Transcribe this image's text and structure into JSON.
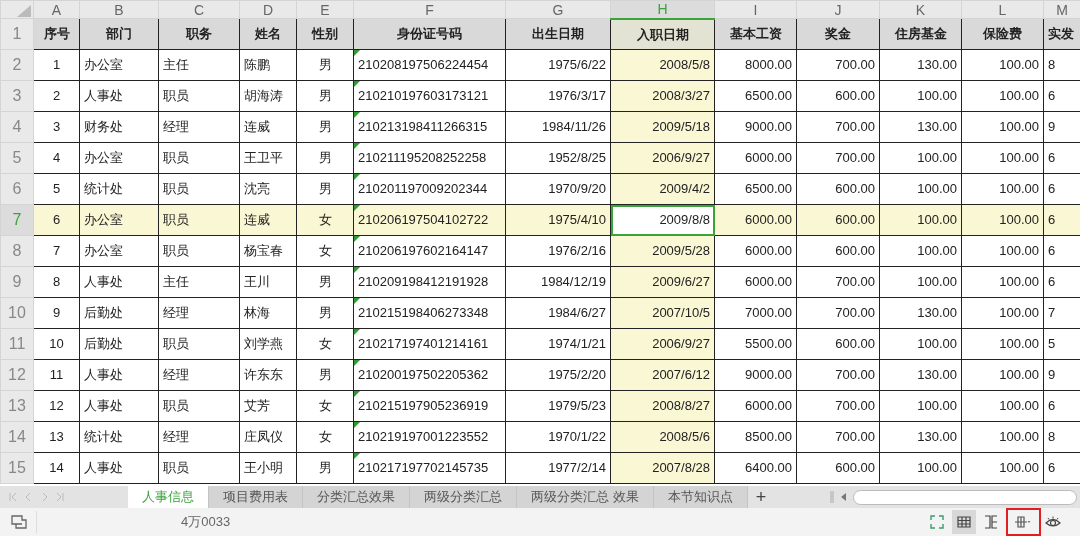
{
  "columns": [
    {
      "letter": "A",
      "header": "序号",
      "kind": "center",
      "selected": false
    },
    {
      "letter": "B",
      "header": "部门",
      "kind": "left",
      "selected": false
    },
    {
      "letter": "C",
      "header": "职务",
      "kind": "left",
      "selected": false
    },
    {
      "letter": "D",
      "header": "姓名",
      "kind": "left",
      "selected": false
    },
    {
      "letter": "E",
      "header": "性别",
      "kind": "center",
      "selected": false
    },
    {
      "letter": "F",
      "header": "身份证号码",
      "kind": "left",
      "selected": false,
      "text_number_flag": true
    },
    {
      "letter": "G",
      "header": "出生日期",
      "kind": "right",
      "selected": false
    },
    {
      "letter": "H",
      "header": "入职日期",
      "kind": "right",
      "selected": true
    },
    {
      "letter": "I",
      "header": "基本工资",
      "kind": "right",
      "selected": false
    },
    {
      "letter": "J",
      "header": "奖金",
      "kind": "right",
      "selected": false
    },
    {
      "letter": "K",
      "header": "住房基金",
      "kind": "right",
      "selected": false
    },
    {
      "letter": "L",
      "header": "保险费",
      "kind": "right",
      "selected": false
    },
    {
      "letter": "M",
      "header": "实发",
      "kind": "left",
      "selected": false
    }
  ],
  "header_row": {
    "number": "1",
    "selected": false
  },
  "rows": [
    {
      "number": "2",
      "selected": false,
      "cells": [
        "1",
        "办公室",
        "主任",
        "陈鹏",
        "男",
        "210208197506224454",
        "1975/6/22",
        "2008/5/8",
        "8000.00",
        "700.00",
        "130.00",
        "100.00",
        "8"
      ]
    },
    {
      "number": "3",
      "selected": false,
      "cells": [
        "2",
        "人事处",
        "职员",
        "胡海涛",
        "男",
        "210210197603173121",
        "1976/3/17",
        "2008/3/27",
        "6500.00",
        "600.00",
        "100.00",
        "100.00",
        "6"
      ]
    },
    {
      "number": "4",
      "selected": false,
      "cells": [
        "3",
        "财务处",
        "经理",
        "连威",
        "男",
        "210213198411266315",
        "1984/11/26",
        "2009/5/18",
        "9000.00",
        "700.00",
        "130.00",
        "100.00",
        "9"
      ]
    },
    {
      "number": "5",
      "selected": false,
      "cells": [
        "4",
        "办公室",
        "职员",
        "王卫平",
        "男",
        "210211195208252258",
        "1952/8/25",
        "2006/9/27",
        "6000.00",
        "700.00",
        "100.00",
        "100.00",
        "6"
      ]
    },
    {
      "number": "6",
      "selected": false,
      "cells": [
        "5",
        "统计处",
        "职员",
        "沈亮",
        "男",
        "210201197009202344",
        "1970/9/20",
        "2009/4/2",
        "6500.00",
        "600.00",
        "100.00",
        "100.00",
        "6"
      ]
    },
    {
      "number": "7",
      "selected": true,
      "cells": [
        "6",
        "办公室",
        "职员",
        "连威",
        "女",
        "210206197504102722",
        "1975/4/10",
        "2009/8/8",
        "6000.00",
        "600.00",
        "100.00",
        "100.00",
        "6"
      ]
    },
    {
      "number": "8",
      "selected": false,
      "cells": [
        "7",
        "办公室",
        "职员",
        "杨宝春",
        "女",
        "210206197602164147",
        "1976/2/16",
        "2009/5/28",
        "6000.00",
        "600.00",
        "100.00",
        "100.00",
        "6"
      ]
    },
    {
      "number": "9",
      "selected": false,
      "cells": [
        "8",
        "人事处",
        "主任",
        "王川",
        "男",
        "210209198412191928",
        "1984/12/19",
        "2009/6/27",
        "6000.00",
        "700.00",
        "100.00",
        "100.00",
        "6"
      ]
    },
    {
      "number": "10",
      "selected": false,
      "cells": [
        "9",
        "后勤处",
        "经理",
        "林海",
        "男",
        "210215198406273348",
        "1984/6/27",
        "2007/10/5",
        "7000.00",
        "700.00",
        "130.00",
        "100.00",
        "7"
      ]
    },
    {
      "number": "11",
      "selected": false,
      "cells": [
        "10",
        "后勤处",
        "职员",
        "刘学燕",
        "女",
        "210217197401214161",
        "1974/1/21",
        "2006/9/27",
        "5500.00",
        "600.00",
        "100.00",
        "100.00",
        "5"
      ]
    },
    {
      "number": "12",
      "selected": false,
      "cells": [
        "11",
        "人事处",
        "经理",
        "许东东",
        "男",
        "210200197502205362",
        "1975/2/20",
        "2007/6/12",
        "9000.00",
        "700.00",
        "130.00",
        "100.00",
        "9"
      ]
    },
    {
      "number": "13",
      "selected": false,
      "cells": [
        "12",
        "人事处",
        "职员",
        "艾芳",
        "女",
        "210215197905236919",
        "1979/5/23",
        "2008/8/27",
        "6000.00",
        "700.00",
        "100.00",
        "100.00",
        "6"
      ]
    },
    {
      "number": "14",
      "selected": false,
      "cells": [
        "13",
        "统计处",
        "经理",
        "庄凤仪",
        "女",
        "210219197001223552",
        "1970/1/22",
        "2008/5/6",
        "8500.00",
        "700.00",
        "130.00",
        "100.00",
        "8"
      ]
    },
    {
      "number": "15",
      "selected": false,
      "cells": [
        "14",
        "人事处",
        "职员",
        "王小明",
        "男",
        "210217197702145735",
        "1977/2/14",
        "2007/8/28",
        "6400.00",
        "600.00",
        "100.00",
        "100.00",
        "6"
      ]
    }
  ],
  "sheet_tabs": [
    {
      "label": "人事信息",
      "selected": true
    },
    {
      "label": "项目费用表",
      "selected": false
    },
    {
      "label": "分类汇总效果",
      "selected": false
    },
    {
      "label": "两级分类汇总",
      "selected": false
    },
    {
      "label": "两级分类汇总 效果",
      "selected": false
    },
    {
      "label": "本节知识点",
      "selected": false
    }
  ],
  "add_sheet": "+",
  "status_bar": {
    "text": "4万0033"
  },
  "view_buttons": [
    {
      "kind": "fullscreen",
      "selected": false,
      "highlighted": false
    },
    {
      "kind": "normal",
      "selected": true,
      "highlighted": false
    },
    {
      "kind": "pagebreak",
      "selected": false,
      "highlighted": false
    },
    {
      "kind": "reading",
      "selected": false,
      "highlighted": true
    },
    {
      "kind": "eye",
      "selected": false,
      "highlighted": false
    }
  ]
}
